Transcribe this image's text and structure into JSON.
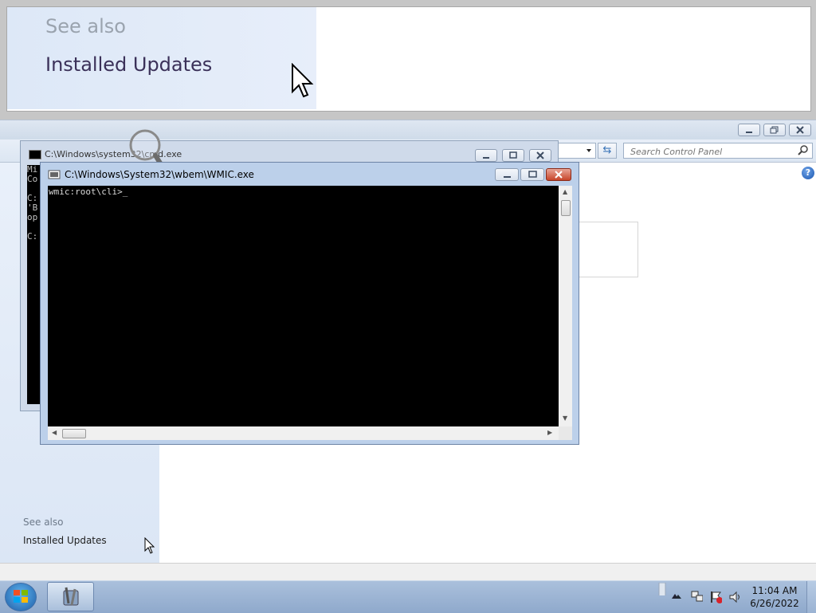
{
  "magnifier": {
    "see_also": "See also",
    "installed_updates": "Installed Updates"
  },
  "control_panel": {
    "search_placeholder": "Search Control Panel",
    "see_also": "See also",
    "installed_updates": "Installed Updates"
  },
  "cmd_window": {
    "title": "C:\\Windows\\system32\\cmd.exe",
    "console_lines": [
      "Mi",
      "Co",
      "",
      "C:",
      "'B",
      "op",
      "",
      "C:"
    ]
  },
  "wmic_window": {
    "title": "C:\\Windows\\System32\\wbem\\WMIC.exe",
    "prompt": "wmic:root\\cli>"
  },
  "taskbar": {
    "time": "11:04 AM",
    "date": "6/26/2022"
  },
  "colors": {
    "taskbar": "#9fb6d6",
    "console_bg": "#000000",
    "close_button": "#c7452a"
  }
}
